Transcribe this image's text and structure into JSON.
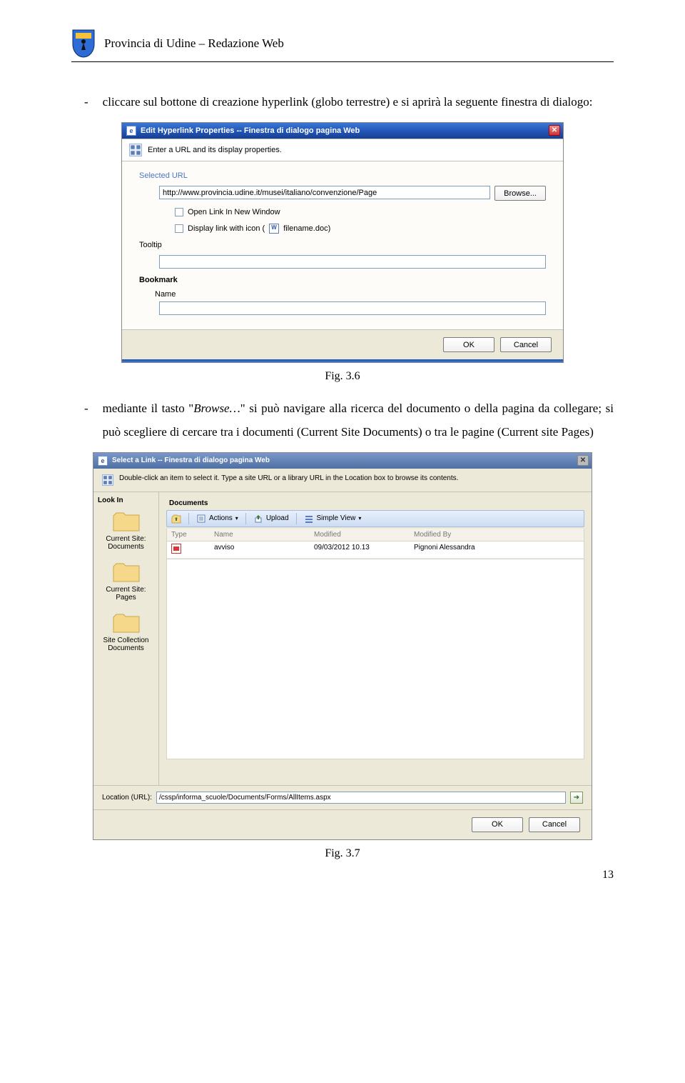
{
  "header": {
    "title": "Provincia di Udine – Redazione Web"
  },
  "para1": {
    "dash": "-",
    "text": "cliccare sul bottone di creazione hyperlink (globo terrestre) e si aprirà la seguente finestra di dialogo:"
  },
  "fig1": "Fig. 3.6",
  "para2": {
    "dash": "-",
    "pre": "mediante il tasto \"",
    "em": "Browse…",
    "post": "\" si può navigare alla ricerca del documento o della pagina da collegare; si può scegliere di cercare tra i documenti (Current Site Documents) o tra le pagine (Current site Pages)"
  },
  "fig2": "Fig. 3.7",
  "pagenum": "13",
  "ss1": {
    "title": "Edit Hyperlink Properties -- Finestra di dialogo pagina Web",
    "instruction": "Enter a URL and its display properties.",
    "selectedUrlLabel": "Selected URL",
    "urlValue": "http://www.provincia.udine.it/musei/italiano/convenzione/Page",
    "browse": "Browse...",
    "openNewWindow": "Open Link In New Window",
    "displayIconPre": "Display link with icon (",
    "displayIconFile": "filename.doc)",
    "tooltip": "Tooltip",
    "bookmark": "Bookmark",
    "name": "Name",
    "ok": "OK",
    "cancel": "Cancel"
  },
  "ss2": {
    "title": "Select a Link -- Finestra di dialogo pagina Web",
    "instruction": "Double-click an item to select it. Type a site URL or a library URL in the Location box to browse its contents.",
    "lookIn": "Look In",
    "leftItems": [
      "Current Site: Documents",
      "Current Site: Pages",
      "Site Collection Documents"
    ],
    "rightLabel": "Documents",
    "toolbar": {
      "up": "",
      "actions": "Actions",
      "upload": "Upload",
      "simpleView": "Simple View"
    },
    "cols": [
      "Type",
      "Name",
      "Modified",
      "Modified By"
    ],
    "row": {
      "name": "avviso",
      "modified": "09/03/2012 10.13",
      "by": "Pignoni Alessandra"
    },
    "locationLabel": "Location (URL):",
    "locationValue": "/cssp/informa_scuole/Documents/Forms/AllItems.aspx",
    "ok": "OK",
    "cancel": "Cancel"
  }
}
